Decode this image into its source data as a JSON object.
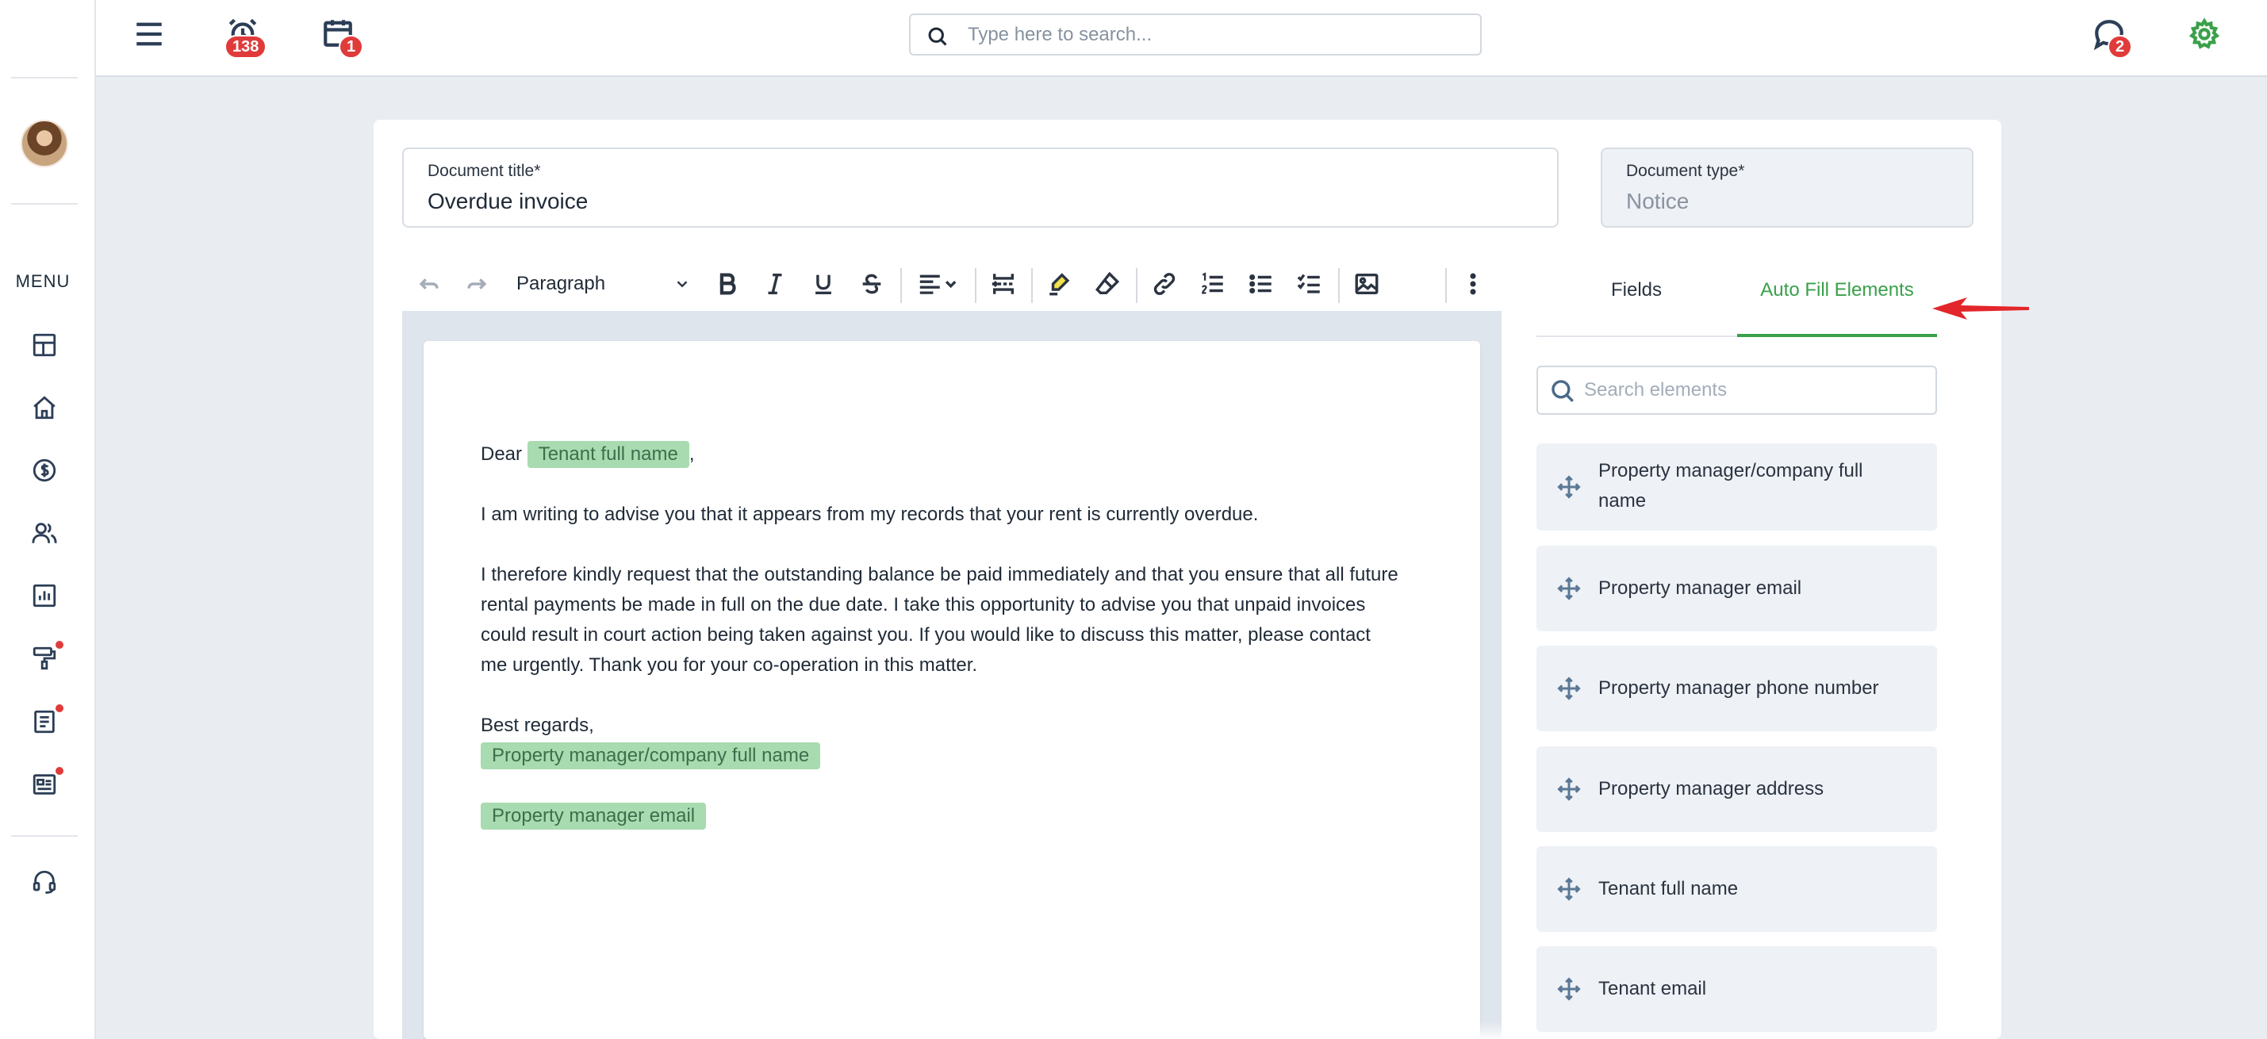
{
  "sidebar": {
    "menu_label": "MENU",
    "items": [
      {
        "name": "dashboard-icon"
      },
      {
        "name": "home-icon"
      },
      {
        "name": "dollar-icon"
      },
      {
        "name": "users-icon"
      },
      {
        "name": "chart-icon"
      },
      {
        "name": "paint-roller-icon"
      },
      {
        "name": "document-icon"
      },
      {
        "name": "newspaper-icon"
      },
      {
        "name": "headset-icon"
      }
    ]
  },
  "topbar": {
    "alarm_badge": "138",
    "calendar_badge": "1",
    "chat_badge": "2",
    "search_placeholder": "Type here to search...",
    "accent_color": "#3aa04a"
  },
  "document": {
    "title_label": "Document title*",
    "title_value": "Overdue invoice",
    "type_label": "Document type*",
    "type_value": "Notice"
  },
  "toolbar": {
    "paragraph_label": "Paragraph"
  },
  "editor": {
    "dear": "Dear",
    "tenant_chip": "Tenant full name",
    "comma": ",",
    "para1": "I am writing to advise you that it appears from my records that your rent is currently overdue.",
    "para2_line1": "I therefore kindly request that the outstanding balance be paid immediately and that you ensure that all future",
    "para2_line2": "rental payments be made in full on the due date. I take this opportunity to advise you that unpaid invoices",
    "para2_line3": "could result in court action being taken against you. If you would like to discuss this matter, please contact",
    "para2_line4": "me urgently. Thank you for your co-operation in this matter.",
    "regards": "Best regards,",
    "pm_name_chip": "Property manager/company full name",
    "pm_email_chip": "Property manager email"
  },
  "panel": {
    "tab_fields": "Fields",
    "tab_autofill": "Auto Fill Elements",
    "search_placeholder": "Search elements",
    "elements": [
      {
        "label": "Property manager/company full name"
      },
      {
        "label": "Property manager email"
      },
      {
        "label": "Property manager phone number"
      },
      {
        "label": "Property manager address"
      },
      {
        "label": "Tenant full name"
      },
      {
        "label": "Tenant email"
      }
    ]
  }
}
